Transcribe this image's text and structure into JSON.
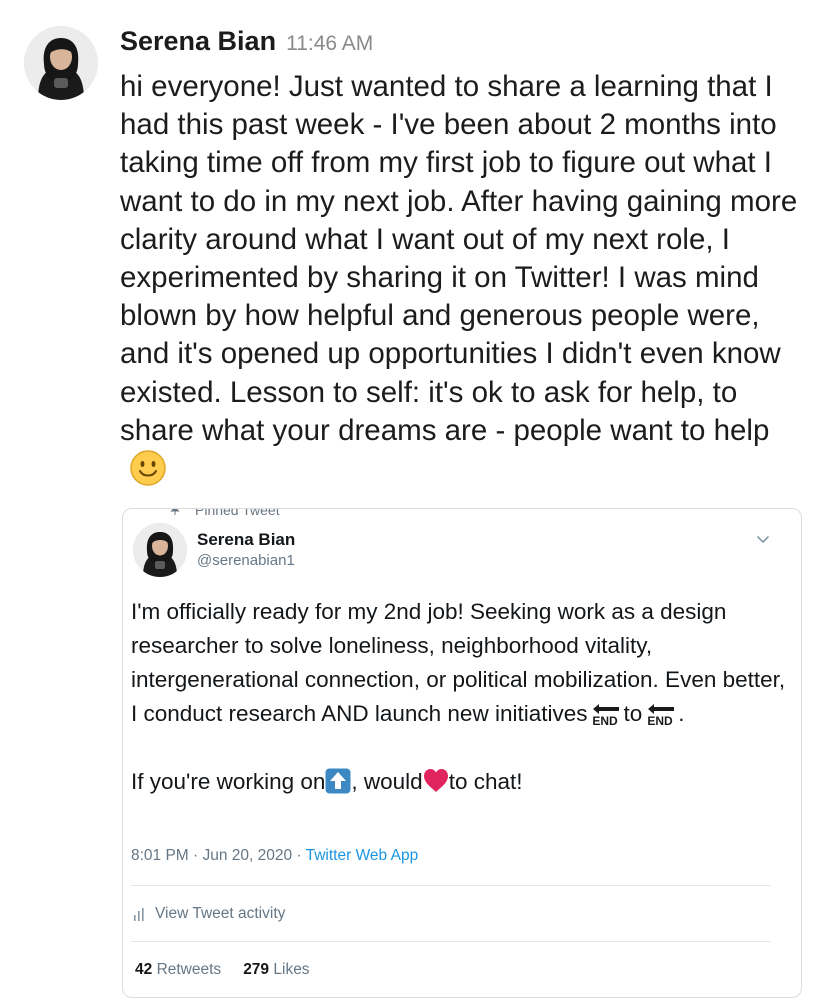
{
  "message": {
    "author": "Serena Bian",
    "timestamp": "11:46 AM",
    "text": "hi everyone! Just wanted to share a learning that I  had this past week - I've been about 2 months into taking time off from my first job to figure out what I want to do in my next job. After having gaining more clarity around what I want out of my next role, I experimented by sharing it on Twitter! I was mind blown by how helpful and generous people were, and it's opened up opportunities I didn't even know existed. Lesson to self: it's ok to ask for help, to share what your dreams are - people want to help",
    "emoji": "slightly-smiling-face"
  },
  "tweet": {
    "pinned_label": "Pinned Tweet",
    "name": "Serena Bian",
    "handle": "@serenabian1",
    "para1_text": "I'm officially ready for my 2nd job! Seeking work as a design researcher to solve loneliness, neighborhood vitality, intergenerational connection, or political mobilization. Even better, I conduct research AND launch new initiatives",
    "para1_to": "to",
    "para1_end": ".",
    "arrow_emoji_label": "END",
    "para2_start": "If you're working on",
    "para2_mid": ", would",
    "para2_end": "to chat!",
    "datetime": "8:01 PM · Jun 20, 2020 · ",
    "source": "Twitter Web App",
    "activity_label": "View Tweet activity",
    "retweets_count": "42",
    "retweets_label": "Retweets",
    "likes_count": "279",
    "likes_label": "Likes"
  },
  "colors": {
    "slack_text": "#1d1c1d",
    "slack_timestamp": "#8a8a8a",
    "twitter_link": "#1b95e0",
    "twitter_secondary": "#657786",
    "heart": "#e0245e",
    "up_button": "#3b88c3"
  }
}
